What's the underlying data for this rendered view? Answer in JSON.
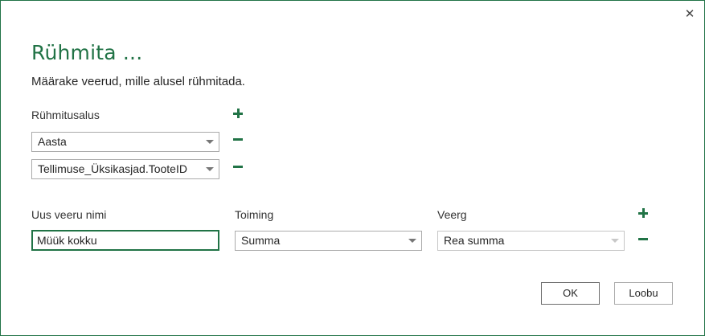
{
  "dialog": {
    "title": "Rühmita ...",
    "description": "Määrake veerud, mille alusel rühmitada.",
    "close_glyph": "✕"
  },
  "group_by": {
    "label": "Rühmitusalus",
    "rows": [
      {
        "value": "Aasta"
      },
      {
        "value": "Tellimuse_Üksikasjad.TooteID"
      }
    ]
  },
  "aggregation": {
    "new_column_label": "Uus veeru nimi",
    "operation_label": "Toiming",
    "column_label": "Veerg",
    "new_column_value": "Müük kokku",
    "operation_value": "Summa",
    "column_value": "Rea summa"
  },
  "buttons": {
    "ok": "OK",
    "cancel": "Loobu"
  },
  "icons": {
    "add": "plus-icon",
    "remove": "minus-icon",
    "close": "close-icon",
    "dropdown": "chevron-down-icon"
  },
  "colors": {
    "accent": "#217346",
    "border": "#ababab"
  }
}
